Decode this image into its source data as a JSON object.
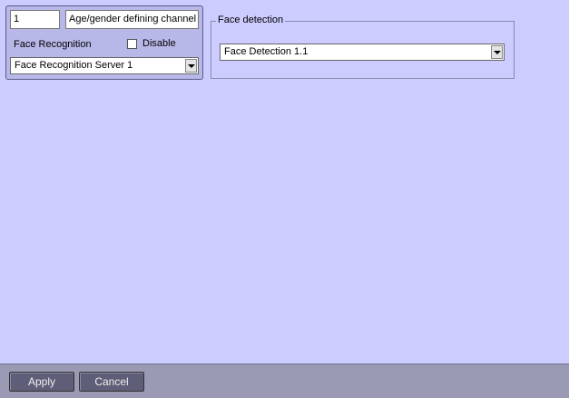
{
  "channel": {
    "id": "1",
    "name": "Age/gender defining channel",
    "recognition_label": "Face Recognition",
    "disable_label": "Disable",
    "disable_checked": false,
    "server_selected": "Face Recognition Server 1"
  },
  "face_detection": {
    "group_title": "Face detection",
    "selected": "Face Detection 1.1"
  },
  "footer": {
    "apply_label": "Apply",
    "cancel_label": "Cancel"
  },
  "colors": {
    "background": "#ccccff",
    "panel": "#b8b8e8",
    "button": "#5e5e78"
  }
}
